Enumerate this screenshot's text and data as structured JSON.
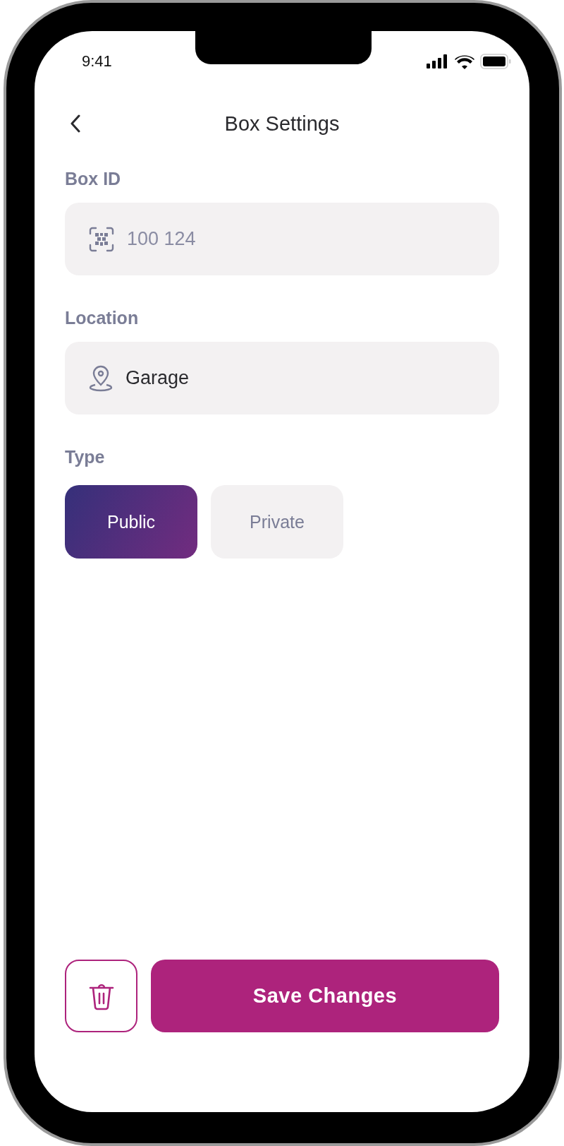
{
  "status_bar": {
    "time": "9:41"
  },
  "header": {
    "title": "Box Settings"
  },
  "fields": [
    {
      "label": "Box ID",
      "kind": "code",
      "value": "100 124",
      "disabled": true
    },
    {
      "label": "Location",
      "kind": "location",
      "value": "Garage",
      "disabled": false
    }
  ],
  "type": {
    "label": "Type",
    "options": [
      {
        "label": "Public",
        "selected": true
      },
      {
        "label": "Private",
        "selected": false
      }
    ]
  },
  "actions": {
    "save_label": "Save Changes"
  }
}
